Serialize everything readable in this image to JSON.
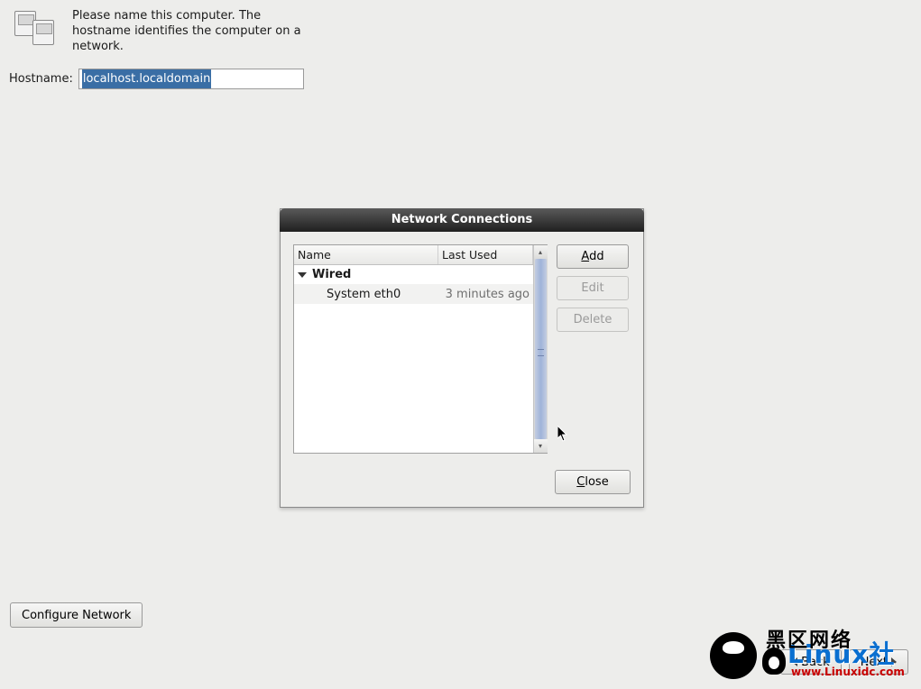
{
  "header": {
    "instruction": "Please name this computer.  The hostname identifies the computer on a network."
  },
  "hostname": {
    "label": "Hostname:",
    "value": "localhost.localdomain"
  },
  "configure_label": "Configure Network",
  "wizard": {
    "back": "Back",
    "next": "Next"
  },
  "dialog": {
    "title": "Network Connections",
    "columns": {
      "name": "Name",
      "last_used": "Last Used"
    },
    "group": "Wired",
    "rows": [
      {
        "name": "System eth0",
        "last_used": "3 minutes ago"
      }
    ],
    "buttons": {
      "add": "Add",
      "edit": "Edit",
      "delete": "Delete",
      "close": "Close"
    }
  },
  "watermark": {
    "big": "黑区网络",
    "blue": "Linux社",
    "url": "www.Linuxidc.com"
  }
}
